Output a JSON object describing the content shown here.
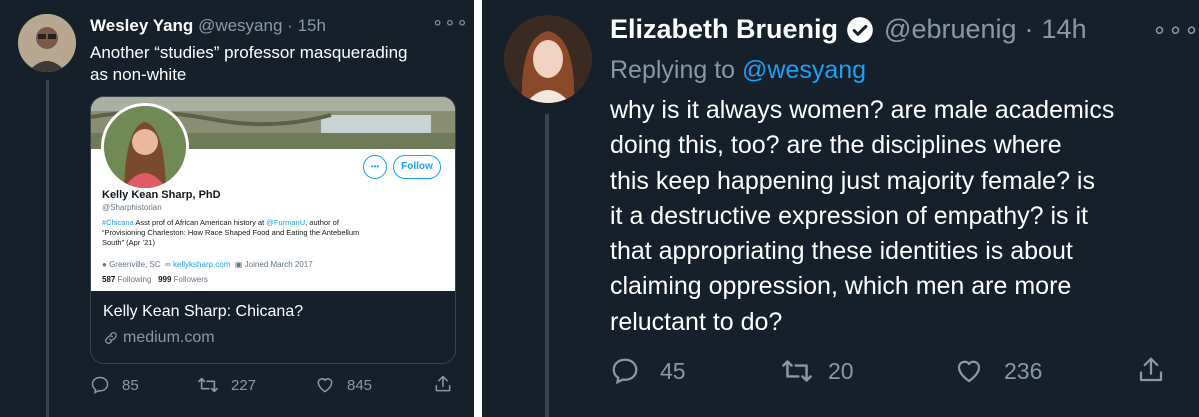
{
  "tweet1": {
    "display_name": "Wesley Yang",
    "handle": "@wesyang",
    "time": "15h",
    "separator": "·",
    "text_line1": "Another “studies” professor masquerading",
    "text_line2": "as non-white",
    "card": {
      "profile_name": "Kelly Kean Sharp, PhD",
      "profile_handle": "@Sharphistorian",
      "bio_tag": "#Chicana",
      "bio_text1": " Asst prof of African American history at ",
      "bio_mention": "@FurmanU",
      "bio_text2": ", author of",
      "bio_line2": "“Provisioning Charleston: How Race Shaped Food and Eating the Antebellum",
      "bio_line3": "South” (Apr ’21)",
      "location": "Greenville, SC",
      "website": "kellyksharp.com",
      "joined": "Joined March 2017",
      "following_count": "587",
      "following_label": "Following",
      "followers_count": "999",
      "followers_label": "Followers",
      "follow_button": "Follow",
      "title": "Kelly Kean Sharp: Chicana?",
      "domain": "medium.com"
    },
    "replies": "85",
    "retweets": "227",
    "likes": "845"
  },
  "tweet2": {
    "display_name": "Elizabeth Bruenig",
    "handle": "@ebruenig",
    "separator": "·",
    "time": "14h",
    "replying_label": "Replying to",
    "replying_handle": "@wesyang",
    "text_lines": [
      "why is it always women? are male academics",
      "doing this, too? are the disciplines where",
      "this keep happening just majority female? is",
      "it a destructive expression of empathy? is it",
      "that appropriating these identities is about",
      "claiming oppression, which men are more",
      "reluctant to do?"
    ],
    "replies": "45",
    "retweets": "20",
    "likes": "236"
  },
  "colors": {
    "background": "#15202b",
    "text": "#ffffff",
    "muted": "#8899a6",
    "accent": "#1da1f2",
    "verified": "#ffffff"
  },
  "icons": [
    "more-icon",
    "reply-icon",
    "retweet-icon",
    "like-icon",
    "share-icon",
    "verified-icon",
    "link-icon",
    "location-icon",
    "calendar-icon"
  ]
}
